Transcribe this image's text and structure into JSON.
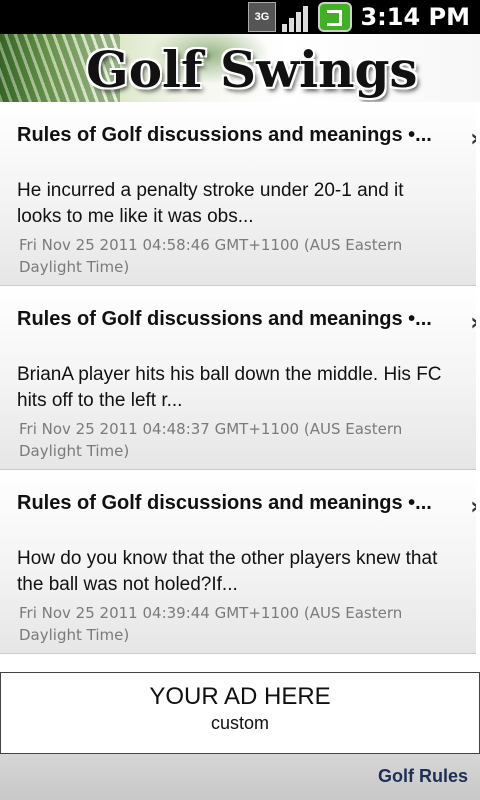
{
  "status_bar": {
    "network": "3G",
    "time": "3:14 PM"
  },
  "banner": {
    "title": "Golf Swings"
  },
  "items": [
    {
      "title": "Rules of Golf discussions and meanings •...",
      "description": "He incurred a penalty stroke under 20-1 and it looks to me like it was obs...",
      "date": "Fri Nov 25 2011 04:58:46 GMT+1100 (AUS Eastern Daylight Time)"
    },
    {
      "title": "Rules of Golf discussions and meanings •...",
      "description": "BrianA player hits his ball down the middle. His FC hits off to the left r...",
      "date": "Fri Nov 25 2011 04:48:37 GMT+1100 (AUS Eastern Daylight Time)"
    },
    {
      "title": "Rules of Golf discussions and meanings •...",
      "description": "How do you know that the other players knew that the ball was not holed?If...",
      "date": "Fri Nov 25 2011 04:39:44 GMT+1100 (AUS Eastern Daylight Time)"
    }
  ],
  "ad": {
    "title": "YOUR AD HERE",
    "subtitle": "custom"
  },
  "footer": {
    "link": "Golf Rules"
  }
}
